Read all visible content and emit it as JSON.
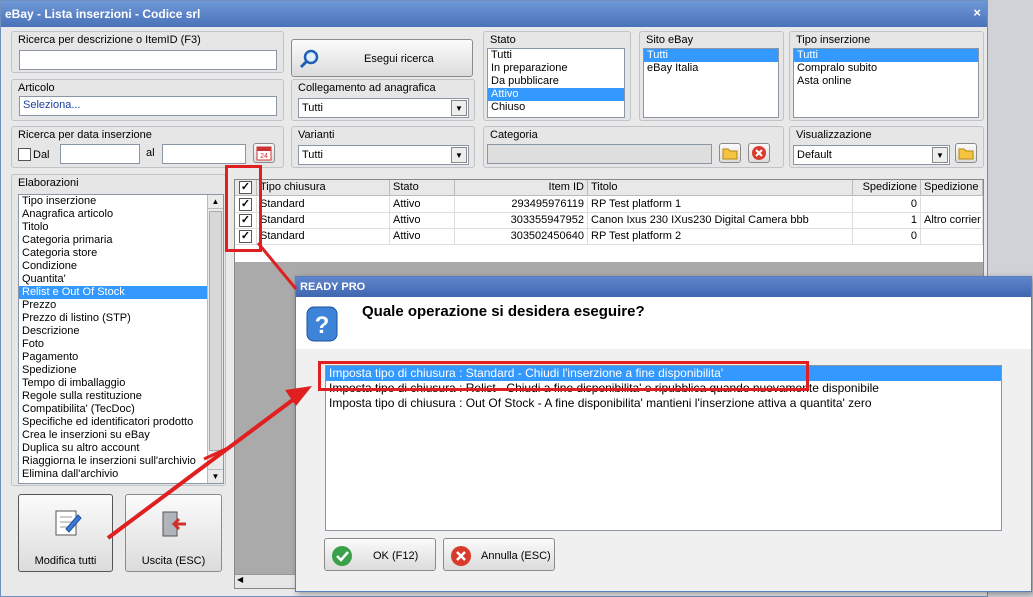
{
  "window": {
    "title": "eBay - Lista inserzioni - Codice srl",
    "close": "×"
  },
  "search": {
    "label": "Ricerca per descrizione o ItemID (F3)",
    "value": "",
    "button": "Esegui ricerca"
  },
  "articolo": {
    "label": "Articolo",
    "value": "Seleziona..."
  },
  "collegamento": {
    "label": "Collegamento ad anagrafica",
    "value": "Tutti"
  },
  "stato": {
    "label": "Stato",
    "options": [
      "Tutti",
      "In preparazione",
      "Da pubblicare",
      "Attivo",
      "Chiuso"
    ],
    "selected": "Attivo"
  },
  "sito": {
    "label": "Sito eBay",
    "options": [
      "Tutti",
      "eBay Italia"
    ],
    "selected": "Tutti"
  },
  "tipo": {
    "label": "Tipo inserzione",
    "options": [
      "Tutti",
      "Compralo subito",
      "Asta online"
    ],
    "selected": "Tutti"
  },
  "data": {
    "label": "Ricerca per data inserzione",
    "dal": "Dal",
    "al": "al",
    "calendar_day": "24"
  },
  "varianti": {
    "label": "Varianti",
    "value": "Tutti"
  },
  "categoria": {
    "label": "Categoria",
    "value": ""
  },
  "visualizzazione": {
    "label": "Visualizzazione",
    "value": "Default"
  },
  "elaborazioni": {
    "label": "Elaborazioni",
    "items": [
      "Tipo inserzione",
      "Anagrafica articolo",
      "Titolo",
      "Categoria primaria",
      "Categoria store",
      "Condizione",
      "Quantita'",
      "Relist e Out Of Stock",
      "Prezzo",
      "Prezzo di listino (STP)",
      "Descrizione",
      "Foto",
      "Pagamento",
      "Spedizione",
      "Tempo di imballaggio",
      "Regole sulla restituzione",
      "Compatibilita' (TecDoc)",
      "Specifiche ed identificatori prodotto",
      "Crea le inserzioni su eBay",
      "Duplica su altro account",
      "Riaggiorna le inserzioni sull'archivio",
      "Elimina dall'archivio"
    ],
    "selected": "Relist e Out Of Stock"
  },
  "actions": {
    "modifica": "Modifica tutti",
    "uscita": "Uscita (ESC)"
  },
  "grid": {
    "columns": [
      "Tipo chiusura",
      "Stato",
      "Item ID",
      "Titolo",
      "Spedizione",
      "Spedizione"
    ],
    "rows": [
      {
        "checked": true,
        "tipo": "Standard",
        "stato": "Attivo",
        "item_id": "293495976119",
        "titolo": "RP Test platform 1",
        "sped": "0",
        "sped2": ""
      },
      {
        "checked": true,
        "tipo": "Standard",
        "stato": "Attivo",
        "item_id": "303355947952",
        "titolo": "Canon Ixus 230 IXus230 Digital Camera bbb",
        "sped": "1",
        "sped2": "Altro corrier"
      },
      {
        "checked": true,
        "tipo": "Standard",
        "stato": "Attivo",
        "item_id": "303502450640",
        "titolo": "RP Test platform 2",
        "sped": "0",
        "sped2": ""
      }
    ]
  },
  "dialog": {
    "title": "READY PRO",
    "question": "Quale operazione si desidera eseguire?",
    "options": [
      "Imposta tipo di chiusura : Standard - Chiudi l'inserzione a fine disponibilita'",
      "Imposta tipo di chiusura : Relist - Chiudi a fine disponibilita' e ripubblica quando nuovamente disponibile",
      "Imposta tipo di chiusura : Out Of Stock - A fine disponibilita' mantieni l'inserzione attiva a quantita' zero"
    ],
    "selected_index": 0,
    "ok": "OK (F12)",
    "cancel": "Annulla (ESC)"
  },
  "colors": {
    "selection": "#3399ff",
    "annotation": "#e02020",
    "title_bar": "#4a72b8"
  }
}
